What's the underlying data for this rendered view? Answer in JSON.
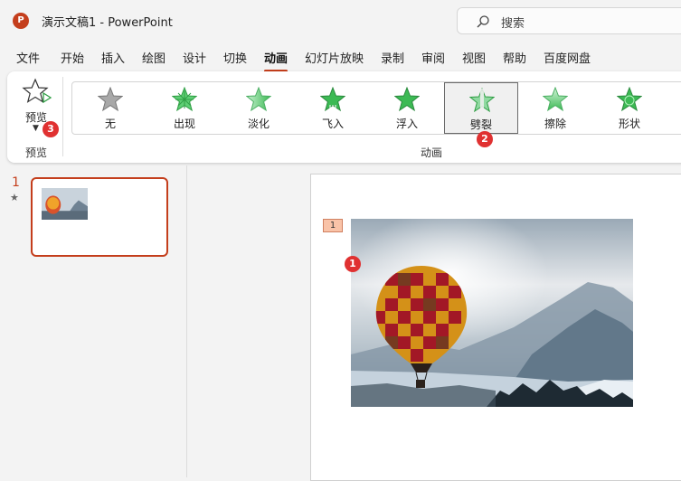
{
  "app": {
    "logo_letter": "P",
    "title": "演示文稿1  -  PowerPoint",
    "search_placeholder": "搜索"
  },
  "tabs": [
    "文件",
    "开始",
    "插入",
    "绘图",
    "设计",
    "切换",
    "动画",
    "幻灯片放映",
    "录制",
    "审阅",
    "视图",
    "帮助",
    "百度网盘"
  ],
  "active_tab": "动画",
  "ribbon": {
    "preview": {
      "label": "预览",
      "group_label": "预览"
    },
    "animation_group_label": "动画",
    "animations": [
      {
        "label": "无",
        "icon": "star-none-icon"
      },
      {
        "label": "出现",
        "icon": "star-appear-icon"
      },
      {
        "label": "淡化",
        "icon": "star-fade-icon"
      },
      {
        "label": "飞入",
        "icon": "star-fly-in-icon"
      },
      {
        "label": "浮入",
        "icon": "star-float-in-icon"
      },
      {
        "label": "劈裂",
        "icon": "star-split-icon"
      },
      {
        "label": "擦除",
        "icon": "star-wipe-icon"
      },
      {
        "label": "形状",
        "icon": "star-shape-icon"
      }
    ],
    "selected_animation": "劈裂"
  },
  "badges": {
    "one": "1",
    "two": "2",
    "three": "3"
  },
  "slides_panel": {
    "slide_number": "1",
    "animation_marker": "★"
  },
  "canvas": {
    "animation_tag": "1"
  },
  "colors": {
    "accent": "#c43e1c",
    "badge": "#e03131",
    "star_green": "#3cba54"
  }
}
